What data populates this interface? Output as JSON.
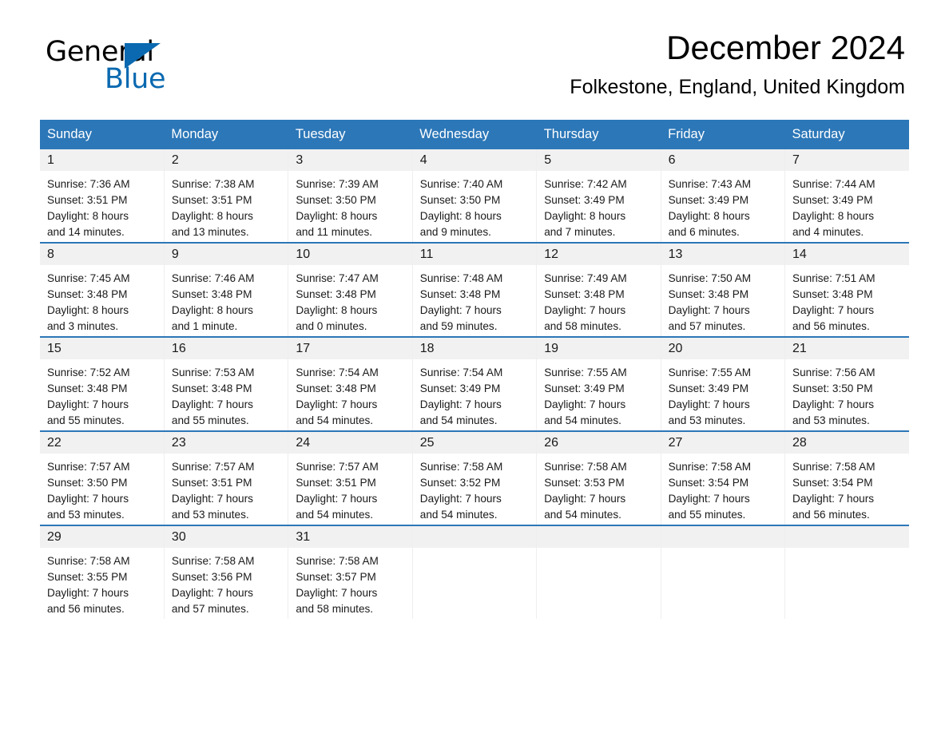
{
  "brand": {
    "name_part1": "General",
    "name_part2": "Blue",
    "accent_color": "#0a69b0"
  },
  "header": {
    "title": "December 2024",
    "subtitle": "Folkestone, England, United Kingdom",
    "header_bg_color": "#2c77b8"
  },
  "weekdays": [
    "Sunday",
    "Monday",
    "Tuesday",
    "Wednesday",
    "Thursday",
    "Friday",
    "Saturday"
  ],
  "weeks": [
    [
      {
        "day": "1",
        "sunrise": "Sunrise: 7:36 AM",
        "sunset": "Sunset: 3:51 PM",
        "daylight_line1": "Daylight: 8 hours",
        "daylight_line2": "and 14 minutes."
      },
      {
        "day": "2",
        "sunrise": "Sunrise: 7:38 AM",
        "sunset": "Sunset: 3:51 PM",
        "daylight_line1": "Daylight: 8 hours",
        "daylight_line2": "and 13 minutes."
      },
      {
        "day": "3",
        "sunrise": "Sunrise: 7:39 AM",
        "sunset": "Sunset: 3:50 PM",
        "daylight_line1": "Daylight: 8 hours",
        "daylight_line2": "and 11 minutes."
      },
      {
        "day": "4",
        "sunrise": "Sunrise: 7:40 AM",
        "sunset": "Sunset: 3:50 PM",
        "daylight_line1": "Daylight: 8 hours",
        "daylight_line2": "and 9 minutes."
      },
      {
        "day": "5",
        "sunrise": "Sunrise: 7:42 AM",
        "sunset": "Sunset: 3:49 PM",
        "daylight_line1": "Daylight: 8 hours",
        "daylight_line2": "and 7 minutes."
      },
      {
        "day": "6",
        "sunrise": "Sunrise: 7:43 AM",
        "sunset": "Sunset: 3:49 PM",
        "daylight_line1": "Daylight: 8 hours",
        "daylight_line2": "and 6 minutes."
      },
      {
        "day": "7",
        "sunrise": "Sunrise: 7:44 AM",
        "sunset": "Sunset: 3:49 PM",
        "daylight_line1": "Daylight: 8 hours",
        "daylight_line2": "and 4 minutes."
      }
    ],
    [
      {
        "day": "8",
        "sunrise": "Sunrise: 7:45 AM",
        "sunset": "Sunset: 3:48 PM",
        "daylight_line1": "Daylight: 8 hours",
        "daylight_line2": "and 3 minutes."
      },
      {
        "day": "9",
        "sunrise": "Sunrise: 7:46 AM",
        "sunset": "Sunset: 3:48 PM",
        "daylight_line1": "Daylight: 8 hours",
        "daylight_line2": "and 1 minute."
      },
      {
        "day": "10",
        "sunrise": "Sunrise: 7:47 AM",
        "sunset": "Sunset: 3:48 PM",
        "daylight_line1": "Daylight: 8 hours",
        "daylight_line2": "and 0 minutes."
      },
      {
        "day": "11",
        "sunrise": "Sunrise: 7:48 AM",
        "sunset": "Sunset: 3:48 PM",
        "daylight_line1": "Daylight: 7 hours",
        "daylight_line2": "and 59 minutes."
      },
      {
        "day": "12",
        "sunrise": "Sunrise: 7:49 AM",
        "sunset": "Sunset: 3:48 PM",
        "daylight_line1": "Daylight: 7 hours",
        "daylight_line2": "and 58 minutes."
      },
      {
        "day": "13",
        "sunrise": "Sunrise: 7:50 AM",
        "sunset": "Sunset: 3:48 PM",
        "daylight_line1": "Daylight: 7 hours",
        "daylight_line2": "and 57 minutes."
      },
      {
        "day": "14",
        "sunrise": "Sunrise: 7:51 AM",
        "sunset": "Sunset: 3:48 PM",
        "daylight_line1": "Daylight: 7 hours",
        "daylight_line2": "and 56 minutes."
      }
    ],
    [
      {
        "day": "15",
        "sunrise": "Sunrise: 7:52 AM",
        "sunset": "Sunset: 3:48 PM",
        "daylight_line1": "Daylight: 7 hours",
        "daylight_line2": "and 55 minutes."
      },
      {
        "day": "16",
        "sunrise": "Sunrise: 7:53 AM",
        "sunset": "Sunset: 3:48 PM",
        "daylight_line1": "Daylight: 7 hours",
        "daylight_line2": "and 55 minutes."
      },
      {
        "day": "17",
        "sunrise": "Sunrise: 7:54 AM",
        "sunset": "Sunset: 3:48 PM",
        "daylight_line1": "Daylight: 7 hours",
        "daylight_line2": "and 54 minutes."
      },
      {
        "day": "18",
        "sunrise": "Sunrise: 7:54 AM",
        "sunset": "Sunset: 3:49 PM",
        "daylight_line1": "Daylight: 7 hours",
        "daylight_line2": "and 54 minutes."
      },
      {
        "day": "19",
        "sunrise": "Sunrise: 7:55 AM",
        "sunset": "Sunset: 3:49 PM",
        "daylight_line1": "Daylight: 7 hours",
        "daylight_line2": "and 54 minutes."
      },
      {
        "day": "20",
        "sunrise": "Sunrise: 7:55 AM",
        "sunset": "Sunset: 3:49 PM",
        "daylight_line1": "Daylight: 7 hours",
        "daylight_line2": "and 53 minutes."
      },
      {
        "day": "21",
        "sunrise": "Sunrise: 7:56 AM",
        "sunset": "Sunset: 3:50 PM",
        "daylight_line1": "Daylight: 7 hours",
        "daylight_line2": "and 53 minutes."
      }
    ],
    [
      {
        "day": "22",
        "sunrise": "Sunrise: 7:57 AM",
        "sunset": "Sunset: 3:50 PM",
        "daylight_line1": "Daylight: 7 hours",
        "daylight_line2": "and 53 minutes."
      },
      {
        "day": "23",
        "sunrise": "Sunrise: 7:57 AM",
        "sunset": "Sunset: 3:51 PM",
        "daylight_line1": "Daylight: 7 hours",
        "daylight_line2": "and 53 minutes."
      },
      {
        "day": "24",
        "sunrise": "Sunrise: 7:57 AM",
        "sunset": "Sunset: 3:51 PM",
        "daylight_line1": "Daylight: 7 hours",
        "daylight_line2": "and 54 minutes."
      },
      {
        "day": "25",
        "sunrise": "Sunrise: 7:58 AM",
        "sunset": "Sunset: 3:52 PM",
        "daylight_line1": "Daylight: 7 hours",
        "daylight_line2": "and 54 minutes."
      },
      {
        "day": "26",
        "sunrise": "Sunrise: 7:58 AM",
        "sunset": "Sunset: 3:53 PM",
        "daylight_line1": "Daylight: 7 hours",
        "daylight_line2": "and 54 minutes."
      },
      {
        "day": "27",
        "sunrise": "Sunrise: 7:58 AM",
        "sunset": "Sunset: 3:54 PM",
        "daylight_line1": "Daylight: 7 hours",
        "daylight_line2": "and 55 minutes."
      },
      {
        "day": "28",
        "sunrise": "Sunrise: 7:58 AM",
        "sunset": "Sunset: 3:54 PM",
        "daylight_line1": "Daylight: 7 hours",
        "daylight_line2": "and 56 minutes."
      }
    ],
    [
      {
        "day": "29",
        "sunrise": "Sunrise: 7:58 AM",
        "sunset": "Sunset: 3:55 PM",
        "daylight_line1": "Daylight: 7 hours",
        "daylight_line2": "and 56 minutes."
      },
      {
        "day": "30",
        "sunrise": "Sunrise: 7:58 AM",
        "sunset": "Sunset: 3:56 PM",
        "daylight_line1": "Daylight: 7 hours",
        "daylight_line2": "and 57 minutes."
      },
      {
        "day": "31",
        "sunrise": "Sunrise: 7:58 AM",
        "sunset": "Sunset: 3:57 PM",
        "daylight_line1": "Daylight: 7 hours",
        "daylight_line2": "and 58 minutes."
      },
      {
        "day": "",
        "sunrise": "",
        "sunset": "",
        "daylight_line1": "",
        "daylight_line2": ""
      },
      {
        "day": "",
        "sunrise": "",
        "sunset": "",
        "daylight_line1": "",
        "daylight_line2": ""
      },
      {
        "day": "",
        "sunrise": "",
        "sunset": "",
        "daylight_line1": "",
        "daylight_line2": ""
      },
      {
        "day": "",
        "sunrise": "",
        "sunset": "",
        "daylight_line1": "",
        "daylight_line2": ""
      }
    ]
  ]
}
